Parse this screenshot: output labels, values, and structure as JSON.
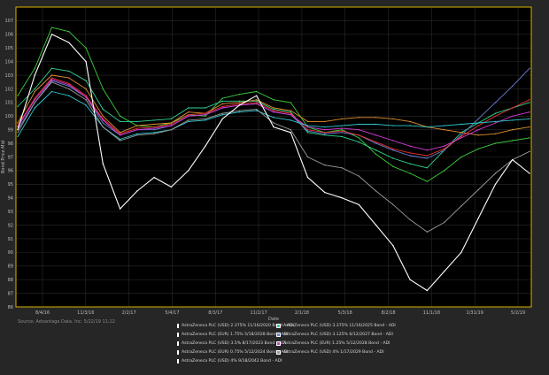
{
  "chart_data": {
    "type": "line",
    "xlabel": "Date",
    "ylabel": "Bond Price Mid",
    "ylim": [
      86,
      108
    ],
    "yticks": [
      86,
      87,
      88,
      89,
      90,
      91,
      92,
      93,
      94,
      95,
      96,
      97,
      98,
      99,
      100,
      101,
      102,
      103,
      104,
      105,
      106,
      107
    ],
    "x_tick_labels": [
      "8/4/16",
      "11/3/16",
      "2/2/17",
      "5/4/17",
      "8/3/17",
      "11/2/17",
      "2/1/18",
      "5/3/18",
      "8/2/18",
      "11/1/18",
      "1/31/19",
      "5/2/19"
    ],
    "grid": true,
    "legend_position": "bottom",
    "source": "Source: Advantage Data. Inc. 5/22/19 11:22",
    "series": [
      {
        "name": "AstraZeneca PLC (USD) 2.375% 11/16/2020 Bond - ADI",
        "color": "#3ecf3e",
        "values": [
          101.5,
          103.5,
          106.5,
          106.2,
          105.0,
          102.0,
          100.0,
          99.3,
          99.2,
          99.5,
          100.1,
          100.0,
          101.3,
          101.6,
          101.8,
          101.2,
          101.0,
          99.2,
          98.8,
          99.0,
          98.4,
          97.2,
          96.3,
          95.8,
          95.2,
          96.0,
          97.0,
          97.6,
          98.0,
          98.2,
          98.4
        ]
      },
      {
        "name": "AstraZeneca PLC (USD) 3.375% 11/16/2025 Bond - ADI",
        "color": "#2fd690",
        "values": [
          100.7,
          102.0,
          103.5,
          103.3,
          102.6,
          100.5,
          99.6,
          99.6,
          99.7,
          99.8,
          100.6,
          100.6,
          101.1,
          101.1,
          101.1,
          100.5,
          100.3,
          98.8,
          98.6,
          98.5,
          98.1,
          97.5,
          96.9,
          96.5,
          96.2,
          97.5,
          98.8,
          99.5,
          100.2,
          100.6,
          101.0
        ]
      },
      {
        "name": "AstraZeneca PLC (EUR) 1.75% 5/18/2028 Bond - ADI",
        "color": "#e09030",
        "values": [
          99.5,
          101.8,
          103.0,
          102.8,
          102.0,
          100.0,
          98.8,
          99.3,
          99.4,
          99.5,
          100.3,
          100.2,
          100.9,
          101.0,
          101.2,
          100.6,
          100.4,
          99.6,
          99.6,
          99.8,
          99.9,
          99.9,
          99.8,
          99.6,
          99.2,
          99.0,
          98.8,
          98.6,
          98.7,
          99.0,
          99.2
        ]
      },
      {
        "name": "AstraZeneca PLC (USD) 3.125% 6/12/2027 Bond - ADI",
        "color": "#6a7fd6",
        "values": [
          99.0,
          101.0,
          102.6,
          102.2,
          101.4,
          99.5,
          98.6,
          99.0,
          99.0,
          99.3,
          100.0,
          100.1,
          100.6,
          100.8,
          100.9,
          100.3,
          100.1,
          98.9,
          98.7,
          98.8,
          98.6,
          98.0,
          97.5,
          97.1,
          96.9,
          97.5,
          98.6,
          99.8,
          101.0,
          102.2,
          103.5
        ]
      },
      {
        "name": "AstraZeneca PLC (USD) 3.5% 8/17/2023 Bond - ADI",
        "color": "#e83030",
        "values": [
          99.3,
          101.3,
          102.8,
          102.4,
          101.5,
          99.8,
          98.7,
          99.1,
          99.2,
          99.4,
          100.1,
          100.2,
          100.7,
          100.9,
          101.0,
          100.4,
          100.2,
          99.0,
          98.8,
          98.9,
          98.6,
          98.1,
          97.6,
          97.3,
          97.1,
          97.6,
          98.5,
          99.3,
          100.0,
          100.6,
          101.2
        ]
      },
      {
        "name": "AstraZeneca PLC (EUR) 1.25% 5/12/2028 Bond - ADI",
        "color": "#d83ad8",
        "values": [
          99.2,
          101.2,
          102.7,
          102.3,
          101.4,
          99.7,
          98.6,
          99.0,
          99.1,
          99.3,
          100.0,
          100.1,
          100.6,
          100.8,
          100.9,
          100.3,
          100.1,
          99.2,
          99.0,
          99.1,
          99.0,
          98.6,
          98.2,
          97.8,
          97.5,
          97.8,
          98.4,
          99.0,
          99.5,
          100.0,
          100.3
        ]
      },
      {
        "name": "AstraZeneca PLC (EUR) 0.75% 5/12/2024 Bond - ADI",
        "color": "#30c8d0",
        "values": [
          98.5,
          100.6,
          101.8,
          101.5,
          100.8,
          99.2,
          98.3,
          98.7,
          98.8,
          99.0,
          99.6,
          99.7,
          100.1,
          100.3,
          100.4,
          99.9,
          99.7,
          99.3,
          99.2,
          99.3,
          99.4,
          99.4,
          99.3,
          99.3,
          99.2,
          99.3,
          99.4,
          99.5,
          99.6,
          99.7,
          99.8
        ]
      },
      {
        "name": "AstraZeneca PLC (USD) 4% 1/17/2029 Bond - ADI",
        "color": "#9a9a9a",
        "values": [
          98.8,
          101.0,
          102.5,
          102.0,
          101.2,
          99.2,
          98.2,
          98.6,
          98.7,
          99.0,
          99.7,
          99.8,
          100.2,
          100.4,
          100.5,
          99.5,
          99.0,
          97.0,
          96.4,
          96.2,
          95.6,
          94.5,
          93.5,
          92.4,
          91.5,
          92.2,
          93.4,
          94.6,
          95.8,
          96.8,
          97.4
        ]
      },
      {
        "name": "AstraZeneca PLC (USD) 4% 9/18/2042 Bond - ADI",
        "color": "#ffffff",
        "values": [
          99.0,
          103.0,
          106.0,
          105.4,
          104.0,
          96.5,
          93.2,
          94.5,
          95.5,
          94.8,
          96.0,
          97.8,
          99.8,
          100.8,
          101.5,
          99.2,
          98.8,
          95.5,
          94.4,
          94.0,
          93.5,
          92.0,
          90.5,
          88.0,
          87.2,
          88.6,
          90.0,
          92.5,
          95.0,
          96.8,
          95.8
        ]
      }
    ]
  }
}
